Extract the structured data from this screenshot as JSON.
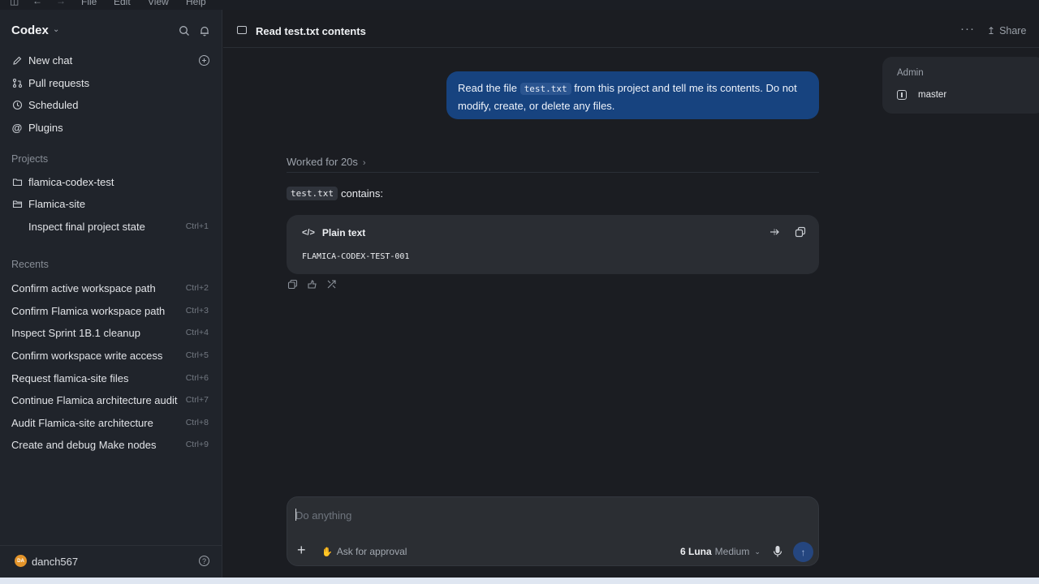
{
  "menubar": {
    "items": [
      "File",
      "Edit",
      "View",
      "Help"
    ]
  },
  "sidebar": {
    "app_name": "Codex",
    "nav": [
      {
        "label": "New chat",
        "icon": "edit-icon"
      },
      {
        "label": "Pull requests",
        "icon": "pull-request-icon"
      },
      {
        "label": "Scheduled",
        "icon": "clock-icon"
      },
      {
        "label": "Plugins",
        "icon": "at-icon"
      }
    ],
    "projects_label": "Projects",
    "projects": [
      {
        "label": "flamica-codex-test",
        "icon": "folder-icon"
      },
      {
        "label": "Flamica-site",
        "icon": "folder-open-icon"
      }
    ],
    "project_thread": {
      "label": "Inspect final project state",
      "shortcut": "Ctrl+1"
    },
    "recents_label": "Recents",
    "recents": [
      {
        "label": "Confirm active workspace path",
        "shortcut": "Ctrl+2"
      },
      {
        "label": "Confirm Flamica workspace path",
        "shortcut": "Ctrl+3"
      },
      {
        "label": "Inspect Sprint 1B.1 cleanup",
        "shortcut": "Ctrl+4"
      },
      {
        "label": "Confirm workspace write access",
        "shortcut": "Ctrl+5"
      },
      {
        "label": "Request flamica-site files",
        "shortcut": "Ctrl+6"
      },
      {
        "label": "Continue Flamica architecture audit",
        "shortcut": "Ctrl+7"
      },
      {
        "label": "Audit Flamica-site architecture",
        "shortcut": "Ctrl+8"
      },
      {
        "label": "Create and debug Make nodes",
        "shortcut": "Ctrl+9"
      }
    ],
    "user": {
      "initials": "DA",
      "name": "danch567",
      "avatar_color": "#e3942a"
    }
  },
  "header": {
    "title": "Read test.txt contents",
    "share_label": "Share"
  },
  "conversation": {
    "user_message": {
      "before": "Read the file ",
      "code": "test.txt",
      "after": " from this project and tell me its contents. Do not modify, create, or delete any files."
    },
    "worked_label": "Worked for 20s",
    "reply": {
      "code": "test.txt",
      "text": "contains:"
    },
    "code_block": {
      "language": "Plain text",
      "content": "FLAMICA-CODEX-TEST-001"
    }
  },
  "environment": {
    "label": "Admin",
    "branch": "master"
  },
  "composer": {
    "placeholder": "Do anything",
    "approval_label": "Ask for approval",
    "model_name": "6 Luna",
    "model_effort": "Medium"
  },
  "colors": {
    "user_bubble": "#17437f",
    "send_button": "#25467f",
    "sidebar_bg": "#20242b",
    "main_bg": "#1b1d22"
  }
}
